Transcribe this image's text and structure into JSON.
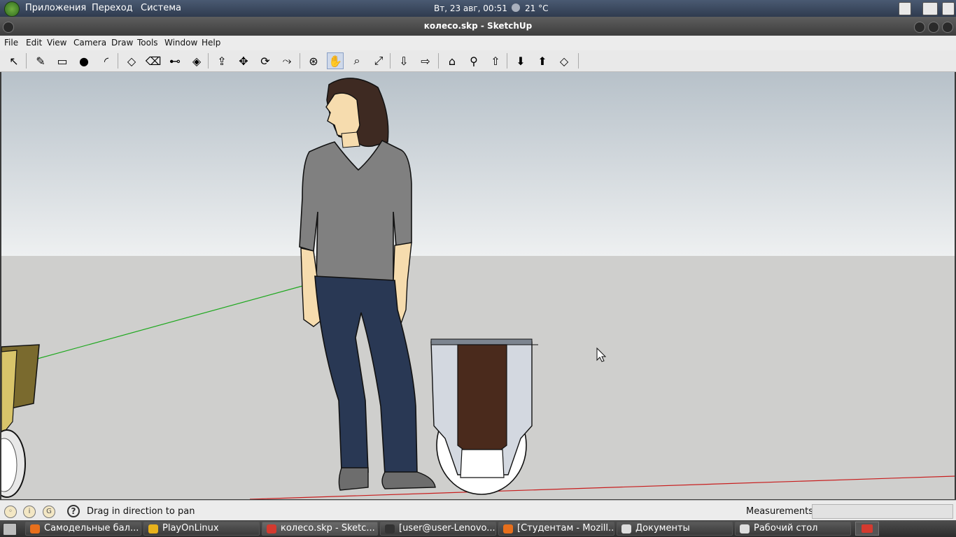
{
  "top_panel": {
    "menu": [
      "Приложения",
      "Переход",
      "Система"
    ],
    "clock": "Вт, 23 авг, 00:51",
    "weather": "21 °C",
    "weather_icon": "moon-icon"
  },
  "window": {
    "title": "колесо.skp - SketchUp"
  },
  "menubar": [
    "File",
    "Edit",
    "View",
    "Camera",
    "Draw",
    "Tools",
    "Window",
    "Help"
  ],
  "toolbar": {
    "tools": [
      {
        "name": "select-icon",
        "glyph": "↖"
      },
      {
        "name": "pencil-icon",
        "glyph": "✎"
      },
      {
        "name": "rectangle-icon",
        "glyph": "▭"
      },
      {
        "name": "circle-icon",
        "glyph": "●"
      },
      {
        "name": "arc-icon",
        "glyph": "◜"
      },
      {
        "name": "make-component-icon",
        "glyph": "◇"
      },
      {
        "name": "eraser-icon",
        "glyph": "⌫"
      },
      {
        "name": "tape-measure-icon",
        "glyph": "⊷"
      },
      {
        "name": "paint-bucket-icon",
        "glyph": "◈"
      },
      {
        "name": "push-pull-icon",
        "glyph": "⇪"
      },
      {
        "name": "move-icon",
        "glyph": "✥"
      },
      {
        "name": "rotate-icon",
        "glyph": "⟳"
      },
      {
        "name": "offset-icon",
        "glyph": "⤳"
      },
      {
        "name": "orbit-icon",
        "glyph": "⊛"
      },
      {
        "name": "pan-icon",
        "glyph": "✋"
      },
      {
        "name": "zoom-icon",
        "glyph": "⌕"
      },
      {
        "name": "zoom-extents-icon",
        "glyph": "⤢"
      },
      {
        "name": "previous-view-icon",
        "glyph": "⇩"
      },
      {
        "name": "next-view-icon",
        "glyph": "⇨"
      },
      {
        "name": "get-models-icon",
        "glyph": "⌂"
      },
      {
        "name": "place-model-icon",
        "glyph": "⚲"
      },
      {
        "name": "share-model-icon",
        "glyph": "⇧"
      },
      {
        "name": "get-photo-texture-icon",
        "glyph": "⬇"
      },
      {
        "name": "share-component-icon",
        "glyph": "⬆"
      },
      {
        "name": "component-icon",
        "glyph": "◇"
      }
    ],
    "active_tool": "pan-icon"
  },
  "statusbar": {
    "hint": "Drag in direction to pan",
    "measurements_label": "Measurements",
    "measurements_value": ""
  },
  "taskbar": {
    "items": [
      {
        "label": "Самодельные бал...",
        "icon": "firefox-icon",
        "color": "#e76f1c"
      },
      {
        "label": "PlayOnLinux",
        "icon": "playonlinux-icon",
        "color": "#e8b21c"
      },
      {
        "label": "колесо.skp - Sketc...",
        "icon": "sketchup-icon",
        "color": "#d43a2f",
        "active": true
      },
      {
        "label": "[user@user-Lenovo...",
        "icon": "terminal-icon",
        "color": "#333333"
      },
      {
        "label": "[Студентам - Mozill...",
        "icon": "firefox-icon",
        "color": "#e76f1c"
      },
      {
        "label": "Документы",
        "icon": "folder-icon",
        "color": "#dddddd"
      },
      {
        "label": "Рабочий стол",
        "icon": "folder-icon",
        "color": "#dddddd"
      }
    ]
  },
  "colors": {
    "sky_top": "#b7c1c9",
    "ground": "#cfcfcd",
    "axis_green": "#1ea81e",
    "axis_red": "#c81e1e",
    "tire_dark": "#4a2a1c"
  }
}
